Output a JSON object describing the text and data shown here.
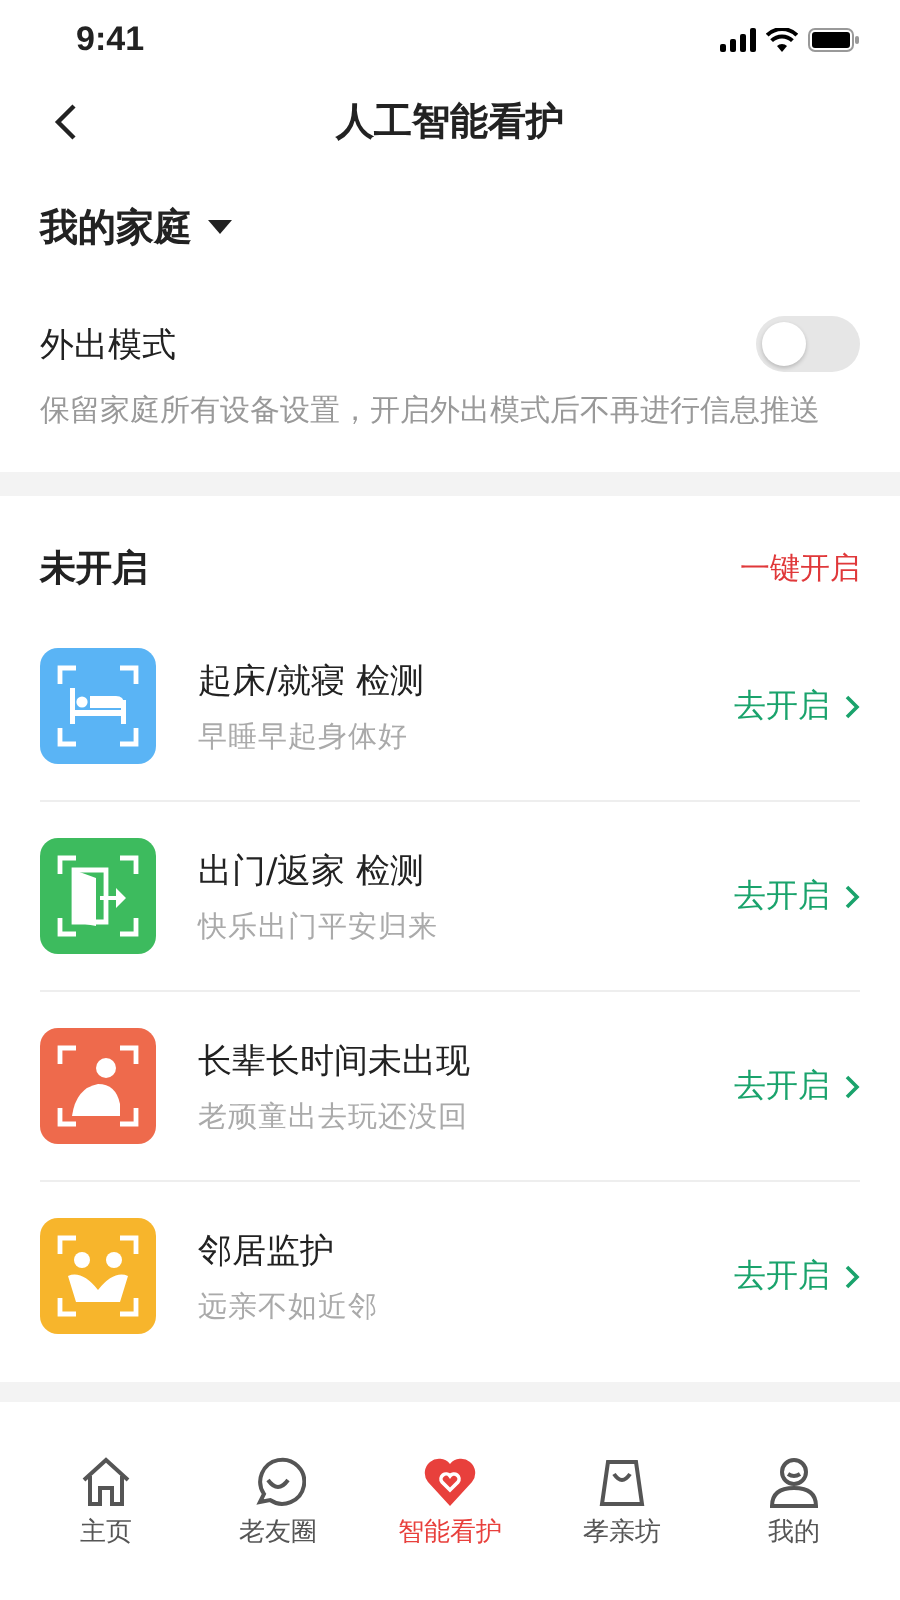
{
  "status_bar": {
    "time": "9:41"
  },
  "nav": {
    "title": "人工智能看护"
  },
  "family": {
    "name": "我的家庭"
  },
  "away_mode": {
    "label": "外出模式",
    "on": false,
    "description": "保留家庭所有设备设置，开启外出模式后不再进行信息推送"
  },
  "section": {
    "title": "未开启",
    "action": "一键开启"
  },
  "items": [
    {
      "kind": "bed",
      "color": "#5ab4f5",
      "title": "起床/就寝 检测",
      "subtitle": "早睡早起身体好",
      "action": "去开启"
    },
    {
      "kind": "door",
      "color": "#3dbb5e",
      "title": "出门/返家 检测",
      "subtitle": "快乐出门平安归来",
      "action": "去开启"
    },
    {
      "kind": "elder",
      "color": "#ee6a4c",
      "title": "长辈长时间未出现",
      "subtitle": "老顽童出去玩还没回",
      "action": "去开启"
    },
    {
      "kind": "neighbor",
      "color": "#f7b52c",
      "title": "邻居监护",
      "subtitle": "远亲不如近邻",
      "action": "去开启"
    }
  ],
  "tab_bar": [
    {
      "kind": "home",
      "label": "主页",
      "selected": false
    },
    {
      "kind": "chat",
      "label": "老友圈",
      "selected": false
    },
    {
      "kind": "heart",
      "label": "智能看护",
      "selected": true
    },
    {
      "kind": "bag",
      "label": "孝亲坊",
      "selected": false
    },
    {
      "kind": "user",
      "label": "我的",
      "selected": false
    }
  ]
}
